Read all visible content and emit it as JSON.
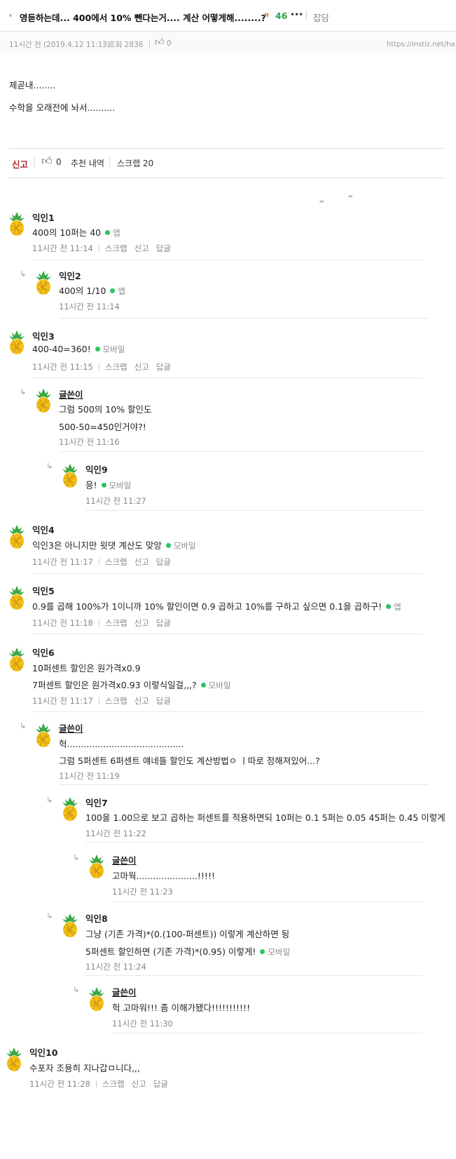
{
  "post": {
    "title": "영듣하는데... 400에서 10% 뺀다는거.... 계산 어떻게해........?",
    "hot_icon": "hot-icon",
    "hot_count": "46",
    "more": "•••",
    "category": "잡담",
    "time": "11시간 전 (2019.4.12 11:13)",
    "views": "조회 2836",
    "likes": "0",
    "url": "https://instiz.net/ha",
    "body": [
      "제곧내........",
      "수학을 오래전에 놔서.........."
    ]
  },
  "actions": {
    "report": "신고",
    "like_count": "0",
    "recommend_history": "추천 내역",
    "scrap": "스크랩 20"
  },
  "colors": {
    "accent_report": "#a0282d",
    "hot": "#2aa34a",
    "device_dot": "#2ec461"
  },
  "comments": [
    {
      "name": "익인1",
      "lines": [
        "400의 10퍼는 40"
      ],
      "device": "앱",
      "time": "11시간 전  11:14",
      "actions": [
        "스크랩",
        "신고",
        "답글"
      ]
    },
    {
      "name": "익인2",
      "lines": [
        "400의 1/10"
      ],
      "device": "앱",
      "time": "11시간 전  11:14",
      "actions": []
    },
    {
      "name": "익인3",
      "lines": [
        "400-40=360!"
      ],
      "device": "모바일",
      "time": "11시간 전  11:15",
      "actions": [
        "스크랩",
        "신고",
        "답글"
      ]
    },
    {
      "name": "글쓴이",
      "lines": [
        "그럼 500의 10% 할인도",
        "500-50=450인거야?!"
      ],
      "device": "",
      "time": "11시간 전  11:16",
      "actions": []
    },
    {
      "name": "익인9",
      "lines": [
        "응!"
      ],
      "device": "모바일",
      "time": "11시간 전  11:27",
      "actions": []
    },
    {
      "name": "익인4",
      "lines": [
        "익인3은 아니지만 윗댓 계산도 맞앙"
      ],
      "device": "모바일",
      "time": "11시간 전  11:17",
      "actions": [
        "스크랩",
        "신고",
        "답글"
      ]
    },
    {
      "name": "익인5",
      "lines": [
        "0.9를 곱해 100%가 1이니까 10% 할인이면 0.9 곱하고 10%를 구하고 싶으면 0.1을 곱하구!"
      ],
      "device": "앱",
      "time": "11시간 전  11:18",
      "actions": [
        "스크랩",
        "신고",
        "답글"
      ]
    },
    {
      "name": "익인6",
      "lines": [
        "10퍼센트 할인은 원가격x0.9",
        "7퍼센트 할인은 원가격x0.93 이렇식일걸,,,?"
      ],
      "device": "모바일",
      "time": "11시간 전  11:17",
      "actions": [
        "스크랩",
        "신고",
        "답글"
      ]
    },
    {
      "name": "글쓴이",
      "lines": [
        "헉..........................................",
        "그럼 5퍼센트 6퍼센트 얘네들 할인도 계산방법ㅇ  ㅣ따로 정해져있어...?"
      ],
      "device": "",
      "time": "11시간 전  11:19",
      "actions": []
    },
    {
      "name": "익인7",
      "lines": [
        "100을 1.00으로 보고 곱하는 퍼센트를 적용하면되 10퍼는 0.1 5퍼는 0.05 45퍼는 0.45 이렇게"
      ],
      "device": "",
      "time": "11시간 전  11:22",
      "actions": []
    },
    {
      "name": "글쓴이",
      "lines": [
        "고마웍......................!!!!!"
      ],
      "device": "",
      "time": "11시간 전  11:23",
      "actions": []
    },
    {
      "name": "익인8",
      "lines": [
        "그냥 (기존 가격)*(0.(100-퍼센트)) 이렇게 계산하면 됭",
        "5퍼센트 할인하면 (기존 가격)*(0.95) 이렇게!"
      ],
      "device": "모바일",
      "time": "11시간 전  11:24",
      "actions": []
    },
    {
      "name": "글쓴이",
      "lines": [
        "헉 고마워!!! 좀 이해가됐다!!!!!!!!!!!"
      ],
      "device": "",
      "time": "11시간 전  11:30",
      "actions": []
    },
    {
      "name": "익인10",
      "lines": [
        "수포자 조용히 지나갑ㅁ니다,,,"
      ],
      "device": "",
      "time": "11시간 전  11:28",
      "actions": [
        "스크랩",
        "신고",
        "답글"
      ]
    }
  ]
}
